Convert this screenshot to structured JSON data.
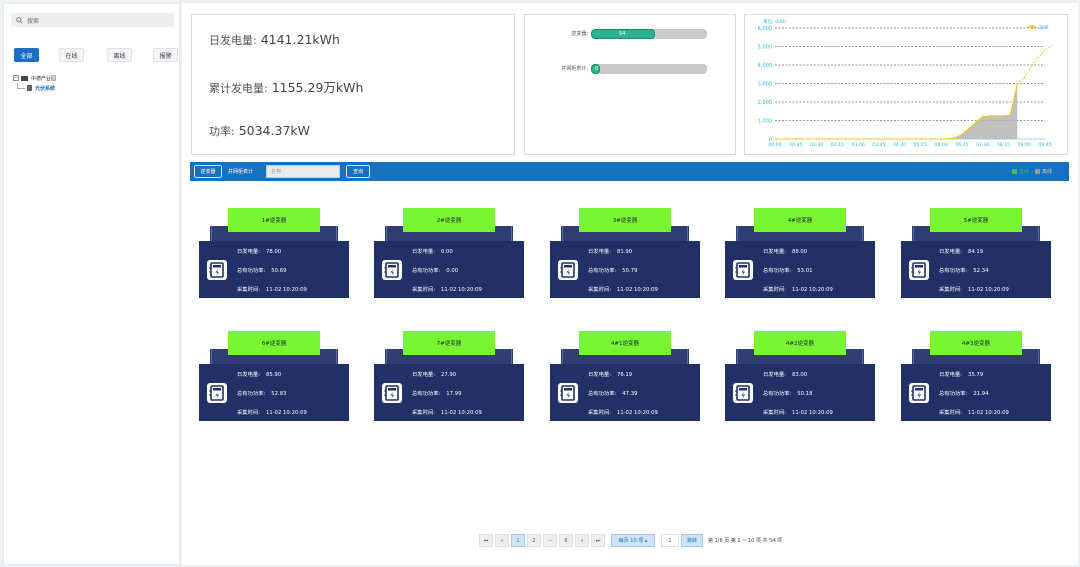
{
  "sidebar": {
    "search_placeholder": "搜索",
    "filters": [
      "全部",
      "在线",
      "离线",
      "报警"
    ],
    "tree": {
      "root_toggle": "−",
      "root_label": "中德产业园",
      "child_label": "光伏系统"
    }
  },
  "stats": {
    "daily_label": "日发电量:",
    "daily_value": "4141.21kWh",
    "total_label": "累计发电量:",
    "total_value": "1155.29万kWh",
    "power_label": "功率:",
    "power_value": "5034.37kW"
  },
  "progress": [
    {
      "label": "逆变器:",
      "value_text": "54",
      "fraction": 0.55
    },
    {
      "label": "并网柜表计:",
      "value_text": "0",
      "fraction": 0.08
    }
  ],
  "chart_data": {
    "type": "area",
    "ylabel": "单位: (kW)",
    "legend": "功率",
    "legend_position": "top-right",
    "y_ticks": [
      "0",
      "1,000",
      "2,000",
      "3,000",
      "4,000",
      "5,000",
      "6,000"
    ],
    "ylim": [
      0,
      6000
    ],
    "x_ticks": [
      "00:00",
      "00:45",
      "01:30",
      "02:15",
      "03:00",
      "03:45",
      "04:30",
      "05:15",
      "06:00",
      "06:45",
      "07:30",
      "08:15",
      "09:00",
      "09:45"
    ],
    "x": [
      "00:00",
      "00:45",
      "01:30",
      "02:15",
      "03:00",
      "03:45",
      "04:30",
      "05:15",
      "06:00",
      "06:15",
      "06:30",
      "06:45",
      "07:00",
      "07:15",
      "07:30",
      "07:45",
      "08:00",
      "08:15",
      "08:30",
      "08:45",
      "09:00",
      "09:15",
      "09:30",
      "09:45",
      "10:00"
    ],
    "series": [
      {
        "name": "功率",
        "values": [
          0,
          0,
          0,
          0,
          0,
          0,
          0,
          0,
          0,
          10,
          60,
          250,
          550,
          900,
          1200,
          1250,
          1250,
          1250,
          1280,
          3000,
          3300,
          3900,
          4400,
          4800,
          5034
        ],
        "solid_until_index": 19
      }
    ],
    "grid": true,
    "color": "#f5c518"
  },
  "toolbar": {
    "inverter_btn": "逆变器",
    "grid_meter_label": "并网柜表计",
    "name_placeholder": "名称",
    "query_btn": "查询",
    "legend_online": "在线",
    "legend_offline": "离线",
    "online_color": "#2ecc40",
    "offline_color": "#999999"
  },
  "cards": [
    {
      "name": "1#逆变器",
      "daily_label": "日发电量:",
      "daily": "78.00",
      "power_label": "总有功功率:",
      "power": "50.69",
      "time_label": "采集时间:",
      "time": "11-02 10:20:09"
    },
    {
      "name": "2#逆变器",
      "daily_label": "日发电量:",
      "daily": "0.00",
      "power_label": "总有功功率:",
      "power": "0.00",
      "time_label": "采集时间:",
      "time": "11-02 10:20:09"
    },
    {
      "name": "3#逆变器",
      "daily_label": "日发电量:",
      "daily": "81.90",
      "power_label": "总有功功率:",
      "power": "50.79",
      "time_label": "采集时间:",
      "time": "11-02 10:20:09"
    },
    {
      "name": "4#逆变器",
      "daily_label": "日发电量:",
      "daily": "88.00",
      "power_label": "总有功功率:",
      "power": "53.01",
      "time_label": "采集时间:",
      "time": "11-02 10:20:09"
    },
    {
      "name": "5#逆变器",
      "daily_label": "日发电量:",
      "daily": "84.19",
      "power_label": "总有功功率:",
      "power": "52.34",
      "time_label": "采集时间:",
      "time": "11-02 10:20:09"
    },
    {
      "name": "6#逆变器",
      "daily_label": "日发电量:",
      "daily": "85.90",
      "power_label": "总有功功率:",
      "power": "52.83",
      "time_label": "采集时间:",
      "time": "11-02 10:20:09"
    },
    {
      "name": "7#逆变器",
      "daily_label": "日发电量:",
      "daily": "27.90",
      "power_label": "总有功功率:",
      "power": "17.99",
      "time_label": "采集时间:",
      "time": "11-02 10:20:09"
    },
    {
      "name": "4#1逆变器",
      "daily_label": "日发电量:",
      "daily": "76.19",
      "power_label": "总有功功率:",
      "power": "47.39",
      "time_label": "采集时间:",
      "time": "11-02 10:20:09"
    },
    {
      "name": "4#2逆变器",
      "daily_label": "日发电量:",
      "daily": "83.00",
      "power_label": "总有功功率:",
      "power": "50.18",
      "time_label": "采集时间:",
      "time": "11-02 10:20:09"
    },
    {
      "name": "4#3逆变器",
      "daily_label": "日发电量:",
      "daily": "35.79",
      "power_label": "总有功功率:",
      "power": "21.94",
      "time_label": "采集时间:",
      "time": "11-02 10:20:09"
    }
  ],
  "pager": {
    "first": "⏮",
    "prev": "«",
    "pages": [
      "1",
      "2",
      "···",
      "6"
    ],
    "current": "1",
    "next": "»",
    "last": "⏭",
    "page_size": "每页 10 项 ▴",
    "jump_value": "1",
    "jump_btn": "跳转",
    "summary": "第 1/6 页  第 1 ~ 10 项  共 54 项"
  }
}
